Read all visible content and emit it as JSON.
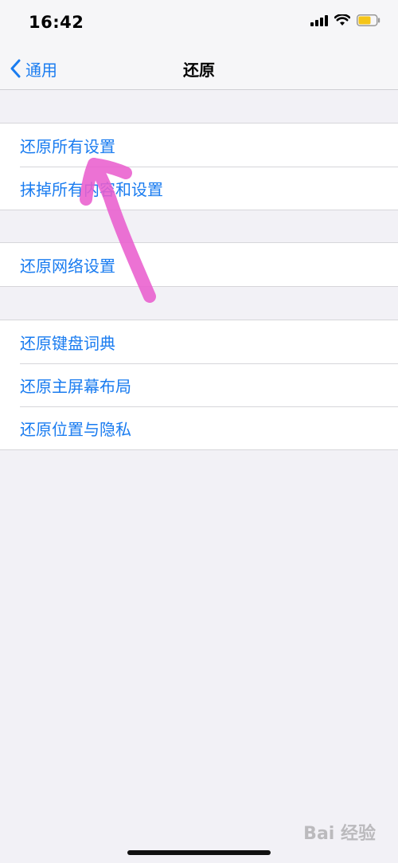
{
  "status_bar": {
    "time": "16:42",
    "icons": [
      "signal-icon",
      "wifi-icon",
      "battery-icon"
    ],
    "battery_color": "#f5c518"
  },
  "nav": {
    "back_label": "通用",
    "title": "还原",
    "accent": "#1a7cf0"
  },
  "groups": [
    {
      "items": [
        {
          "label": "还原所有设置"
        },
        {
          "label": "抹掉所有内容和设置"
        }
      ]
    },
    {
      "items": [
        {
          "label": "还原网络设置"
        }
      ]
    },
    {
      "items": [
        {
          "label": "还原键盘词典"
        },
        {
          "label": "还原主屏幕布局"
        },
        {
          "label": "还原位置与隐私"
        }
      ]
    }
  ],
  "annotation": {
    "type": "arrow",
    "color": "#ea5fcf"
  },
  "watermark": {
    "text": "Bai 经验"
  }
}
